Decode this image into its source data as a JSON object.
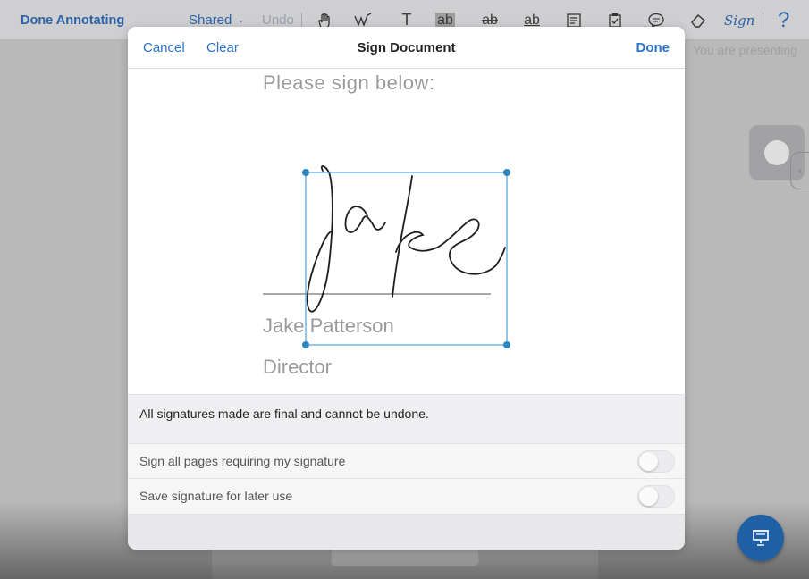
{
  "app": {
    "toolbar": {
      "done_annotating": "Done Annotating",
      "shared": "Shared",
      "undo": "Undo",
      "tools": [
        {
          "icon": "hand-icon",
          "glyph": "☝"
        },
        {
          "icon": "pen-icon",
          "glyph": "✎"
        },
        {
          "icon": "text-tool-icon",
          "glyph": "T"
        },
        {
          "icon": "highlight-icon",
          "glyph": "ab"
        },
        {
          "icon": "strikethrough-icon",
          "glyph": "ab"
        },
        {
          "icon": "underline-icon",
          "glyph": "ab"
        },
        {
          "icon": "note-icon",
          "glyph": "▤"
        },
        {
          "icon": "stamp-icon",
          "glyph": "☑"
        },
        {
          "icon": "comment-icon",
          "glyph": "💬"
        },
        {
          "icon": "eraser-icon",
          "glyph": "◇"
        }
      ],
      "sign_tool": "Sign",
      "help": "?"
    },
    "presenting": "You are presenting"
  },
  "modal": {
    "cancel": "Cancel",
    "clear": "Clear",
    "title": "Sign Document",
    "done": "Done",
    "prompt": "Please sign below:",
    "signer_name": "Jake Patterson",
    "signer_title": "Director",
    "notice": "All signatures made are final and cannot be undone.",
    "options": [
      {
        "label": "Sign all pages requiring my signature",
        "enabled": false
      },
      {
        "label": "Save signature for later use",
        "enabled": false
      }
    ]
  },
  "colors": {
    "accent": "#2a73c7",
    "selection": "#2e86c1",
    "present_button": "#1f5fa3"
  }
}
